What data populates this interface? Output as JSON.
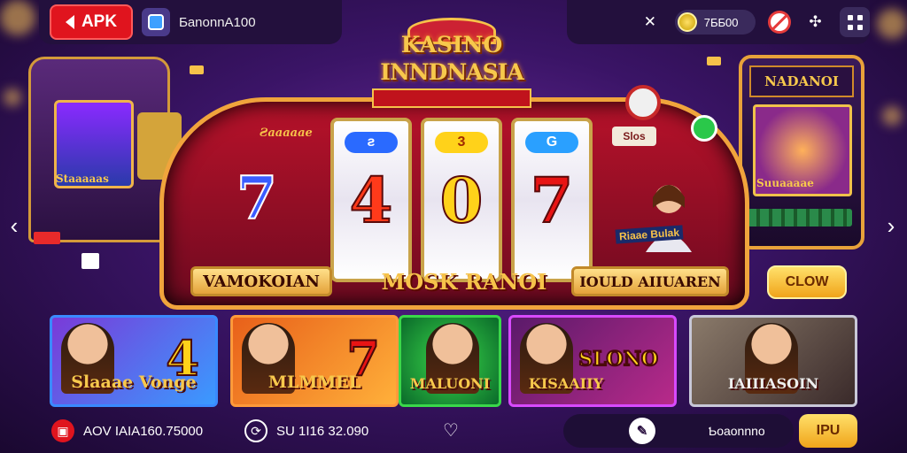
{
  "header": {
    "apk_label": "APK",
    "app_name": "ƂanonnA100",
    "coin_balance": "7ƂƂ00"
  },
  "title": {
    "line1": "KASINO",
    "line2": "INNDNASIA"
  },
  "machine": {
    "left_label": "Ƨaaaaae",
    "left_symbol": "7",
    "reels": [
      {
        "top": "ƨ",
        "symbol": "4",
        "color": "#ff3a1a"
      },
      {
        "top": "3",
        "symbol": "0",
        "color": "#ffd21a"
      },
      {
        "top": "G",
        "symbol": "7",
        "color": "#e81414"
      }
    ],
    "slot_tag": "Slos",
    "hero_caption": "Riaae Bulak",
    "plate_left": "VAMOKOIAN",
    "plate_center": "MOSK RANOI",
    "plate_right": "IOULD AIIUAREN"
  },
  "left_arcade": {
    "label": "Staaaaas"
  },
  "right_arcade": {
    "marquee": "NADANOI",
    "label": "Suuaaaae"
  },
  "claim_label": "CLOW",
  "cards": [
    {
      "title": "Slaaae Vonge",
      "symbol": "4",
      "border": "#3a8aff",
      "bg": "linear-gradient(135deg,#7a3ad8,#3a9aff)",
      "sym_color": "#ffd21a"
    },
    {
      "title": "MLMMEL",
      "symbol": "7",
      "border": "#ff9a3a",
      "bg": "linear-gradient(135deg,#e8601a,#ffb03a)",
      "sym_color": "#e81414"
    },
    {
      "title": "MALUONI",
      "symbol": "",
      "border": "#3ad84a",
      "bg": "radial-gradient(circle,#3ad84a,#0a6a2a)",
      "sym_color": "#fff"
    },
    {
      "title": "KISAAIIY",
      "symbol": "SLONO",
      "border": "#d84aff",
      "bg": "linear-gradient(135deg,#5a1a6a,#b82a8a)",
      "sym_color": "#ffd21a"
    },
    {
      "title": "IAIIIASOIN",
      "symbol": "",
      "border": "#c8c8d8",
      "bg": "linear-gradient(135deg,#8a7a6a,#3a2a2a)",
      "sym_color": "#fff"
    }
  ],
  "footer": {
    "stat1": "AOV IAIA160.75000",
    "stat2": "SU 1I16 32.090",
    "pill_text": "Ƅoaonnno",
    "pay_label": "IPU"
  }
}
